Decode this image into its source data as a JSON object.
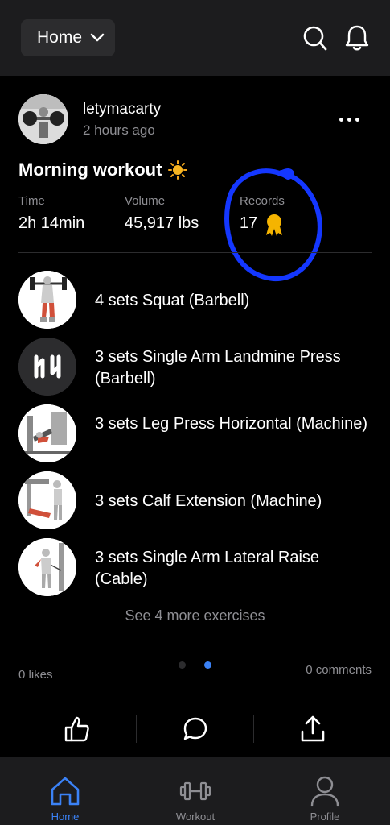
{
  "header": {
    "dropdown_label": "Home"
  },
  "post": {
    "username": "letymacarty",
    "time_ago": "2 hours ago",
    "title": "Morning workout",
    "stats": [
      {
        "label": "Time",
        "value": "2h 14min"
      },
      {
        "label": "Volume",
        "value": "45,917 lbs"
      },
      {
        "label": "Records",
        "value": "17"
      }
    ],
    "exercises": [
      {
        "text": "4 sets Squat (Barbell)"
      },
      {
        "text": "3 sets Single Arm Landmine Press (Barbell)"
      },
      {
        "text": "3 sets Leg Press Horizontal (Machine)"
      },
      {
        "text": "3 sets Calf Extension (Machine)"
      },
      {
        "text": "3 sets Single Arm Lateral Raise (Cable)"
      }
    ],
    "see_more": "See 4 more exercises",
    "likes": "0 likes",
    "comments": "0 comments"
  },
  "nav": {
    "home": "Home",
    "workout": "Workout",
    "profile": "Profile"
  },
  "colors": {
    "accent": "#3b82f6",
    "annotation": "#1437ff",
    "medal": "#f5b400"
  }
}
